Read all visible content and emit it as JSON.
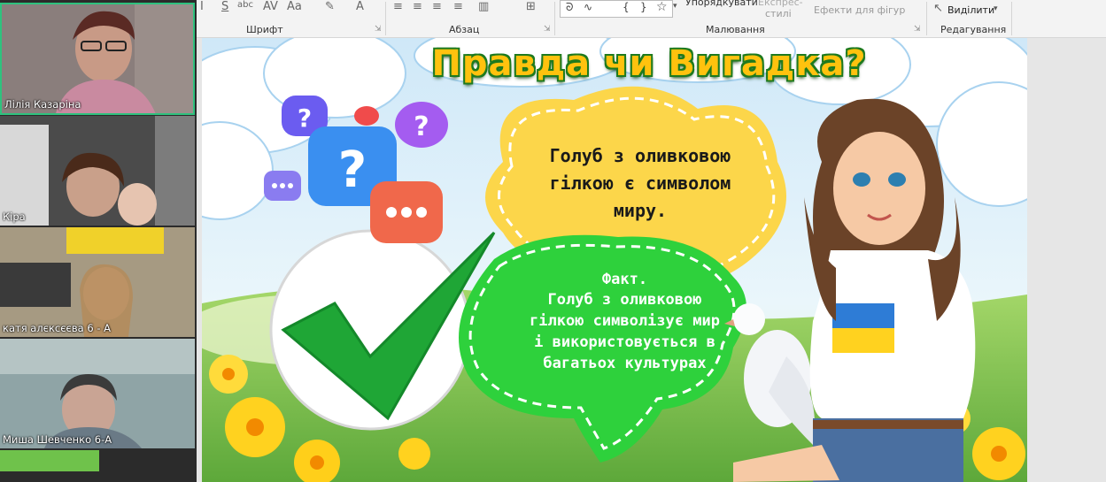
{
  "participants": [
    {
      "name": "Лілія Казаріна",
      "active": true
    },
    {
      "name": "Кіра",
      "active": false
    },
    {
      "name": "катя алєксєєва 6 - А",
      "active": false
    },
    {
      "name": "Миша Шевченко 6-А",
      "active": false
    }
  ],
  "ribbon": {
    "groups": {
      "font": "Шрифт",
      "paragraph": "Абзац",
      "drawing": "Малювання",
      "editing": "Редагування"
    },
    "arrange_label": "Упорядкувати",
    "quick_styles_line1": "Експрес-",
    "quick_styles_line2": "стилі",
    "shape_effects_label": "Ефекти для фігур",
    "select_label": "Виділити"
  },
  "slide": {
    "title": "Правда чи Вигадка?",
    "statement": "Голуб з оливковою гілкою є символом миру.",
    "fact_heading": "Факт.",
    "fact_text": "Голуб з оливковою гілкою символізує мир і використовується в багатьох культурах"
  },
  "colors": {
    "title_yellow": "#ffc20e",
    "title_outline": "#1e7a1e",
    "statement_bubble": "#fcd64a",
    "fact_bubble": "#2ed13c",
    "check_green": "#1fa636",
    "active_speaker": "#2ec27e",
    "cloud_blue": "#b9dcf3",
    "field_green": "#8fca5a"
  },
  "icons": [
    "check-icon",
    "question-bubble-icon",
    "chat-dots-icon",
    "dove-icon",
    "select-cursor-icon",
    "star-icon",
    "chevron-down-icon"
  ]
}
